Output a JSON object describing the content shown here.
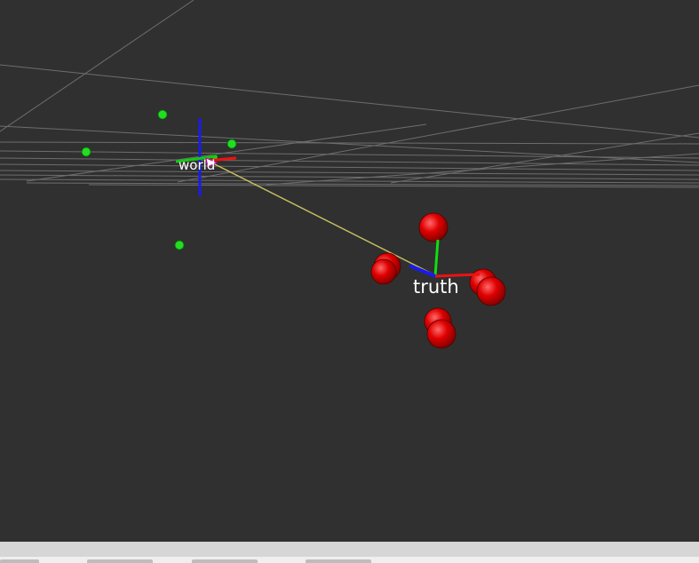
{
  "view": {
    "background_color": "#303030",
    "grid_color": "#a0a0a0",
    "point_color": "#00cc00",
    "sphere_color": "#ee0000",
    "link_color": "#c8c060"
  },
  "frames": {
    "world": {
      "label": "world",
      "axes": [
        "red",
        "green",
        "blue"
      ]
    },
    "truth": {
      "label": "truth",
      "axes": [
        "red",
        "green",
        "blue"
      ]
    }
  },
  "markers": {
    "green_points_count": 5,
    "red_spheres_count": 7
  },
  "bottom_panel": {
    "tabs": [
      "",
      "",
      "",
      ""
    ]
  }
}
